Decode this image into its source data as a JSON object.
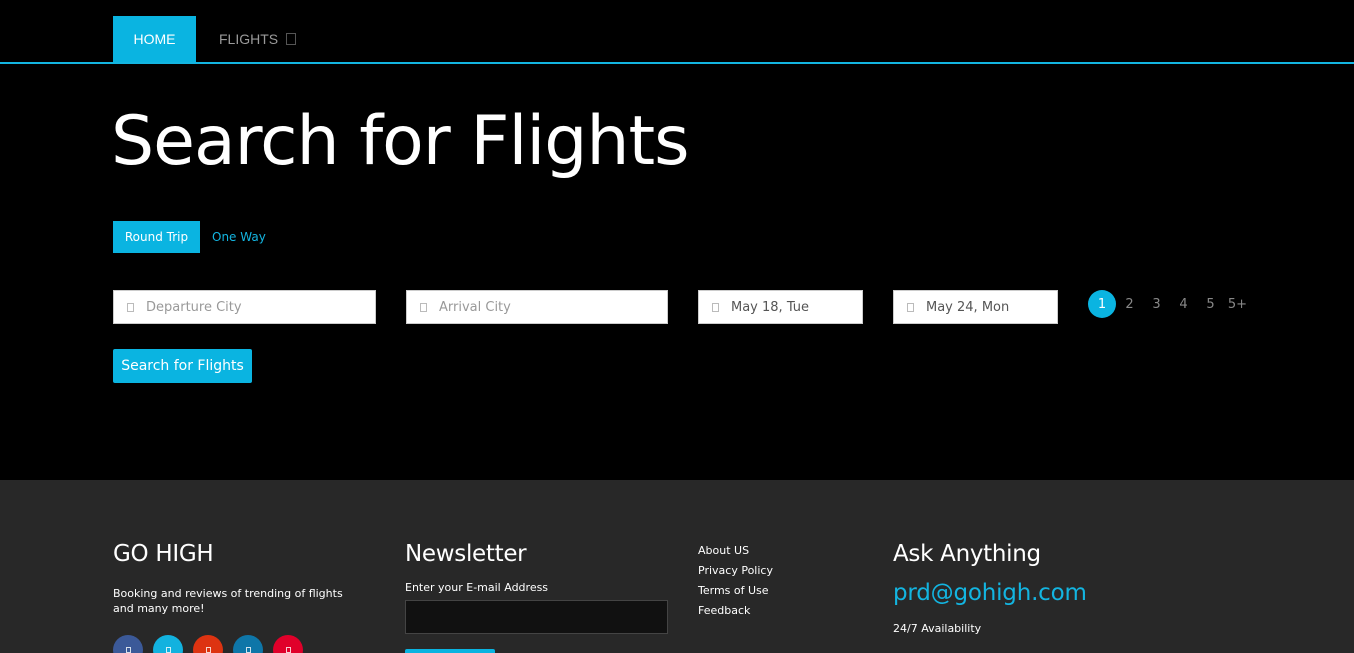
{
  "nav": {
    "home_label": "HOME",
    "flights_label": "FLIGHTS",
    "accent": "#0ab4e1"
  },
  "hero": {
    "title": "Search for Flights",
    "trip_types": [
      "Round Trip",
      "One Way"
    ],
    "selected_trip": "Round Trip",
    "fields": {
      "departure_placeholder": "Departure City",
      "arrival_placeholder": "Arrival City",
      "depart_date": "May 18, Tue",
      "return_date": "May 24, Mon"
    },
    "passengers": {
      "options": [
        "1",
        "2",
        "3",
        "4",
        "5",
        "5+"
      ],
      "selected": "1"
    },
    "search_button": "Search for Flights"
  },
  "footer": {
    "brand": "GO HIGH",
    "tagline": "Booking and reviews of trending of flights and many more!",
    "newsletter_title": "Newsletter",
    "email_label": "Enter your E-mail Address",
    "links": [
      "About US",
      "Privacy Policy",
      "Terms of Use",
      "Feedback"
    ],
    "ask_title": "Ask Anything",
    "contact_email": "prd@gohigh.com",
    "availability": "24/7 Availability",
    "socials": [
      {
        "icon": "facebook-icon",
        "color": "#3b5998"
      },
      {
        "icon": "twitter-icon",
        "color": "#12b2df"
      },
      {
        "icon": "google-plus-icon",
        "color": "#dd3311"
      },
      {
        "icon": "linkedin-icon",
        "color": "#0e76a8"
      },
      {
        "icon": "pinterest-icon",
        "color": "#e0002a"
      }
    ],
    "background": "#282828"
  }
}
